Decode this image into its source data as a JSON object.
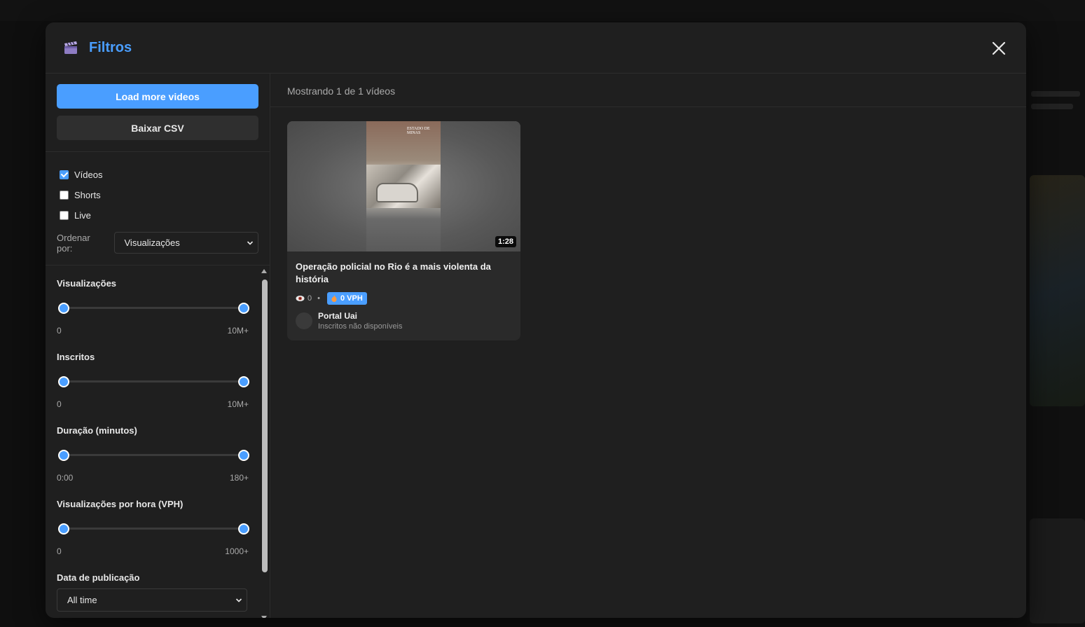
{
  "modal": {
    "title": "Filtros",
    "close_icon": "close-icon",
    "logo_icon": "clapperboard-icon"
  },
  "sidebar": {
    "load_more_label": "Load more videos",
    "download_csv_label": "Baixar CSV",
    "checkboxes": [
      {
        "label": "Vídeos",
        "checked": true
      },
      {
        "label": "Shorts",
        "checked": false
      },
      {
        "label": "Live",
        "checked": false
      }
    ],
    "order_label": "Ordenar por:",
    "order_value": "Visualizações",
    "ranges": [
      {
        "label": "Visualizações",
        "min": "0",
        "max": "10M+"
      },
      {
        "label": "Inscritos",
        "min": "0",
        "max": "10M+"
      },
      {
        "label": "Duração (minutos)",
        "min": "0:00",
        "max": "180+"
      },
      {
        "label": "Visualizações por hora (VPH)",
        "min": "0",
        "max": "1000+"
      }
    ],
    "date_label": "Data de publicação",
    "date_value": "All time"
  },
  "main": {
    "results_text": "Mostrando 1 de 1 vídeos",
    "videos": [
      {
        "title": "Operação policial no Rio é a mais violenta da história",
        "duration": "1:28",
        "views": "0",
        "vph": "0 VPH",
        "channel": "Portal Uai",
        "subscribers": "Inscritos não disponíveis",
        "thumbnail_masthead": "ESTADO DE MINAS"
      }
    ]
  },
  "colors": {
    "accent": "#4a9eff",
    "modal_bg": "#1f1f1f",
    "card_bg": "#2a2a2a"
  }
}
